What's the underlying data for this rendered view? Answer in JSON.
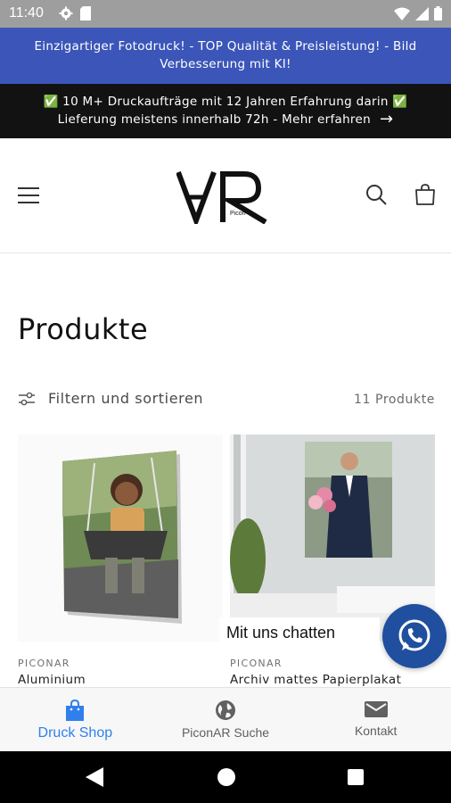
{
  "status_bar": {
    "time": "11:40"
  },
  "promo_bar": {
    "text": "Einzigartiger Fotodruck! - TOP Qualität & Preisleistung! - Bild Verbesserung mit KI!"
  },
  "info_bar": {
    "line1": "✅ 10 M+ Druckaufträge mit 12 Jahren Erfahrung darin ✅",
    "line2": "Lieferung meistens innerhalb 72h - Mehr erfahren",
    "arrow": "→"
  },
  "header": {
    "logo_text": "Picon",
    "icons": [
      "menu-icon",
      "search-icon",
      "cart-icon"
    ]
  },
  "page": {
    "title": "Produkte"
  },
  "filters": {
    "label": "Filtern und sortieren",
    "count": "11 Produkte"
  },
  "products": [
    {
      "vendor": "PICONAR",
      "title": "Aluminium"
    },
    {
      "vendor": "PICONAR",
      "title": "Archiv mattes Papierplakat"
    }
  ],
  "chat": {
    "label": "Mit uns chatten"
  },
  "bottom_nav": {
    "items": [
      {
        "label": "Druck Shop",
        "icon": "shopping-bag-icon",
        "active": true
      },
      {
        "label": "PiconAR Suche",
        "icon": "globe-icon",
        "active": false
      },
      {
        "label": "Kontakt",
        "icon": "mail-icon",
        "active": false
      }
    ]
  },
  "colors": {
    "promo_bg": "#3b56b8",
    "info_bg": "#121212",
    "active_nav": "#2f80ed",
    "whatsapp_bg": "#1f4f9e"
  }
}
